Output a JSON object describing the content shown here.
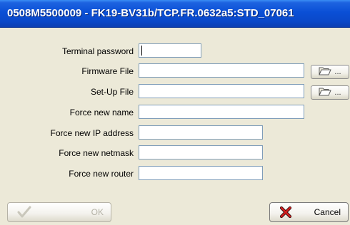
{
  "window": {
    "title": "0508M5500009 - FK19-BV31b/TCP.FR.0632a5:STD_07061"
  },
  "form": {
    "terminal_password": {
      "label": "Terminal password",
      "value": ""
    },
    "firmware_file": {
      "label": "Firmware File",
      "value": "",
      "browse_label": "..."
    },
    "setup_file": {
      "label": "Set-Up File",
      "value": "",
      "browse_label": "..."
    },
    "force_new_name": {
      "label": "Force new name",
      "value": ""
    },
    "force_new_ip": {
      "label": "Force new IP address",
      "value": ""
    },
    "force_new_netmask": {
      "label": "Force new netmask",
      "value": ""
    },
    "force_new_router": {
      "label": "Force new router",
      "value": ""
    }
  },
  "buttons": {
    "ok": {
      "label": "OK",
      "enabled": false
    },
    "cancel": {
      "label": "Cancel",
      "enabled": true
    }
  },
  "icons": {
    "browse": "folder-icon",
    "ok": "check-icon",
    "cancel": "red-x-icon"
  }
}
